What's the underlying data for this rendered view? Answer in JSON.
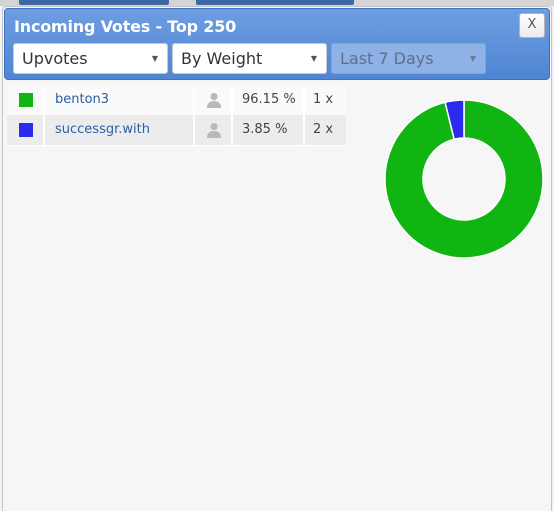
{
  "dialog": {
    "title": "Incoming Votes - Top 250",
    "close_label": "X"
  },
  "filters": {
    "type": "Upvotes",
    "metric": "By Weight",
    "period": "Last 7 Days"
  },
  "votes": [
    {
      "user": "benton3",
      "percent": "96.15 %",
      "count": "1 x",
      "color": "#11b511"
    },
    {
      "user": "successgr.with",
      "percent": "3.85 %",
      "count": "2 x",
      "color": "#2b2bef"
    }
  ],
  "chart_data": {
    "type": "pie",
    "variant": "donut",
    "labels": [
      "benton3",
      "successgr.with"
    ],
    "values": [
      96.15,
      3.85
    ],
    "colors": [
      "#11b511",
      "#2b2bef"
    ]
  }
}
